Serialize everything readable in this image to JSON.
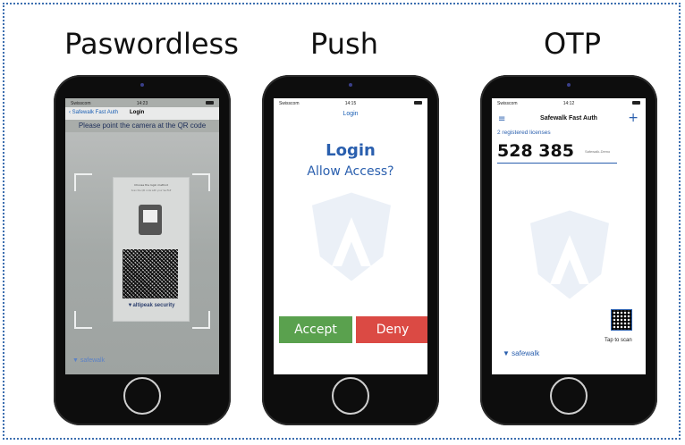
{
  "columns": [
    {
      "title": "Paswordless"
    },
    {
      "title": "Push"
    },
    {
      "title": "OTP"
    }
  ],
  "passwordless": {
    "status": {
      "carrier": "Swisscom",
      "time": "14:23"
    },
    "back_label": "Safewalk Fast Auth",
    "nav_title": "Login",
    "hint": "Please point the camera at the QR code",
    "paper_heading": "Choose the login method",
    "paper_sub": "Scan the QR code with your SecFAP",
    "paper_brand": "altipeak security",
    "bottom_brand": "safewalk"
  },
  "push": {
    "status": {
      "carrier": "Swisscom",
      "time": "14:15"
    },
    "nav_title": "Login",
    "heading": "Login",
    "question": "Allow Access?",
    "accept_label": "Accept",
    "deny_label": "Deny"
  },
  "otp": {
    "status": {
      "carrier": "Swisscom",
      "time": "14:12"
    },
    "title": "Safewalk Fast Auth",
    "menu_glyph": "≡",
    "add_glyph": "+",
    "registered": "2 registered licenses",
    "code": "528 385",
    "license_label": "Safewalk-Demo",
    "tap_label": "Tap to scan",
    "brand": "safewalk"
  },
  "colors": {
    "accent": "#2a5fae",
    "accept": "#5aa14e",
    "deny": "#db4a44",
    "border": "#3d6fb0"
  }
}
